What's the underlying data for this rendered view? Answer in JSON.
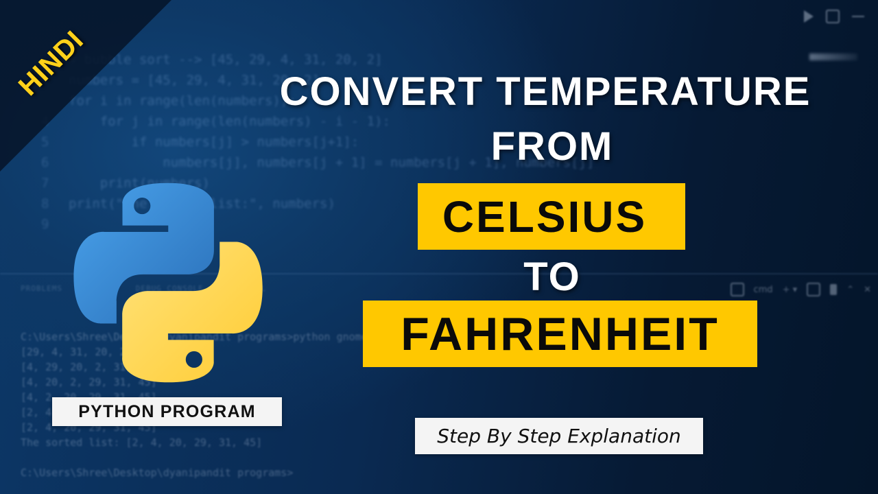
{
  "badge": {
    "text": "HINDI",
    "color": "#ffd11a"
  },
  "title": {
    "line1": "CONVERT TEMPERATURE",
    "line2": "FROM",
    "from_unit": "CELSIUS",
    "connector": "TO",
    "to_unit": "FAHRENHEIT",
    "highlight_color": "#ffc800"
  },
  "logo": {
    "name": "python-logo",
    "blue": "#3a8ad6",
    "yellow": "#ffd84a"
  },
  "labels": {
    "program": "PYTHON PROGRAM",
    "explanation": "Step By Step Explanation"
  },
  "background_code": {
    "lines": [
      {
        "num": "",
        "text": "# bubble sort --> [45, 29, 4, 31, 20, 2]"
      },
      {
        "num": "",
        "text": "numbers = [45, 29, 4, 31, 20, 2]"
      },
      {
        "num": "",
        "text": "for i in range(len(numbers)):"
      },
      {
        "num": "4",
        "text": "    for j in range(len(numbers) - i - 1):"
      },
      {
        "num": "5",
        "text": "        if numbers[j] > numbers[j+1]:"
      },
      {
        "num": "6",
        "text": "            numbers[j], numbers[j + 1] = numbers[j + 1], numbers[j]"
      },
      {
        "num": "7",
        "text": "    print(numbers)"
      },
      {
        "num": "8",
        "text": "print(\"The sorted list:\", numbers)"
      },
      {
        "num": "9",
        "text": ""
      }
    ],
    "panel_tabs": "PROBLEMS    OUTPUT    DEBUG CONSOLE    TERMINAL",
    "terminal": [
      "C:\\Users\\Shree\\Desktop\\dyanipandit programs>python gnome.py",
      "[29, 4, 31, 20, 2, 45]",
      "[4, 29, 20, 2, 31, 45]",
      "[4, 20, 2, 29, 31, 45]",
      "[4, 2, 20, 29, 31, 45]",
      "[2, 4, 20, 29, 31, 45]",
      "[2, 4, 20, 29, 31, 45]",
      "The sorted list: [2, 4, 20, 29, 31, 45]",
      "",
      "C:\\Users\\Shree\\Desktop\\dyanipandit programs>"
    ],
    "terminal_label": "cmd"
  }
}
